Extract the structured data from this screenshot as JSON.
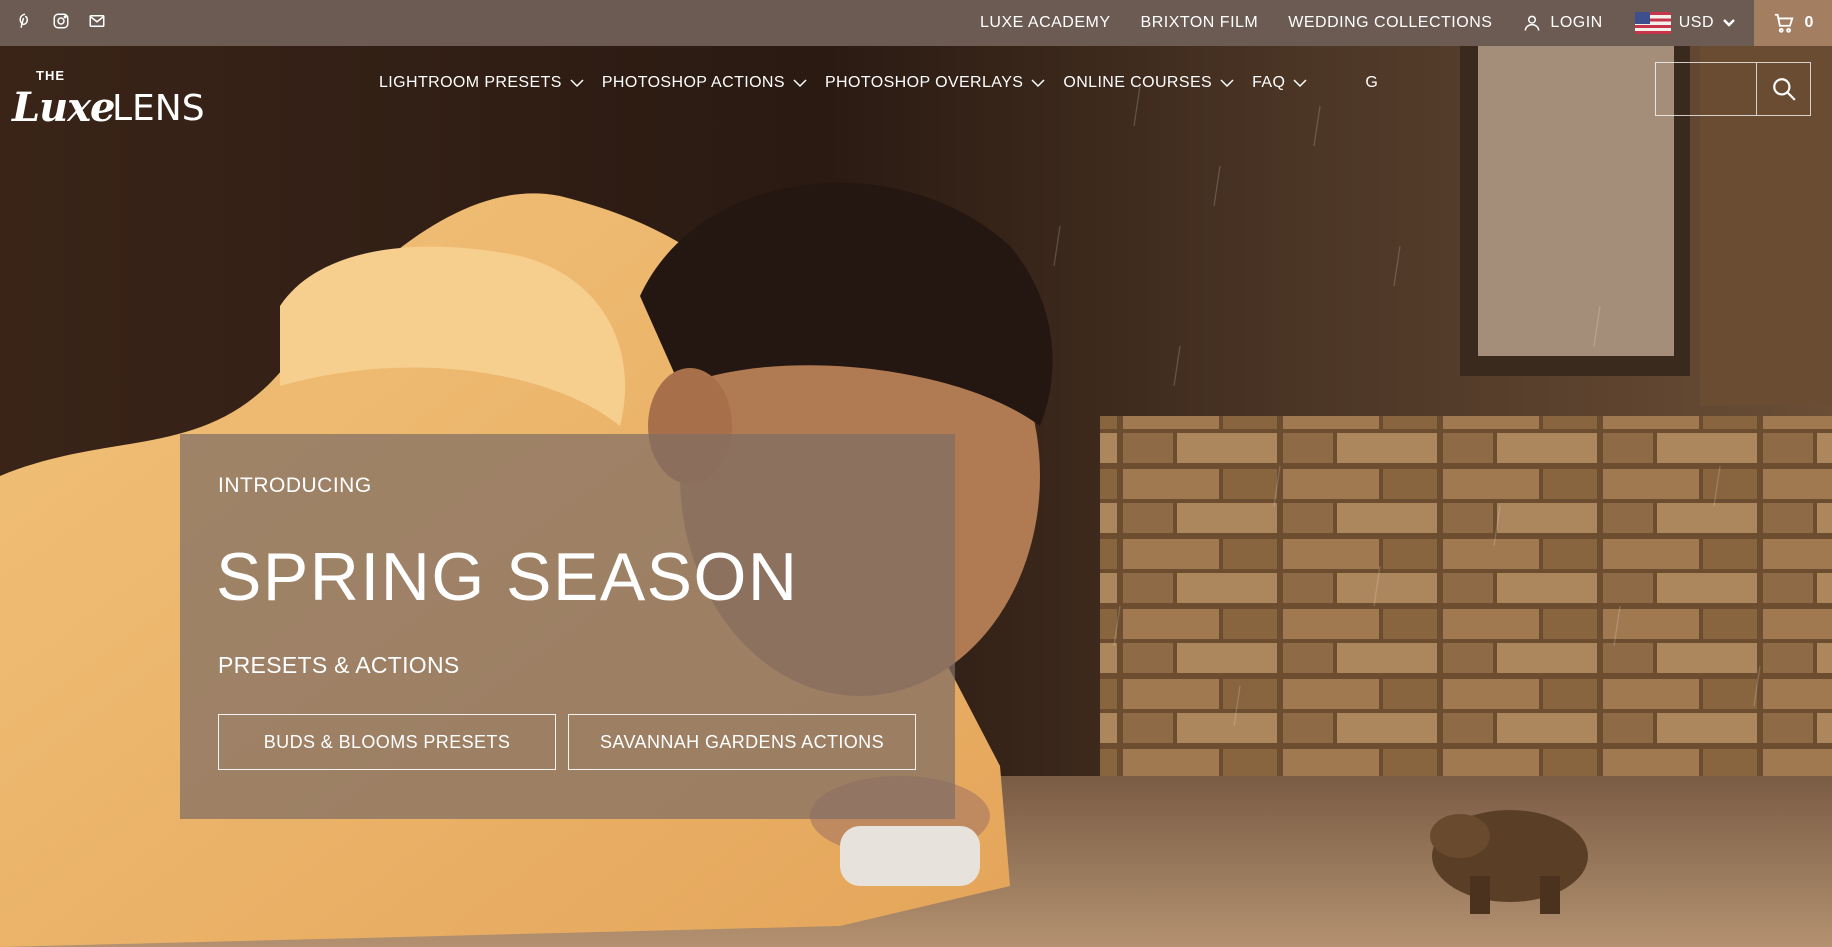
{
  "topbar": {
    "social": [
      "pinterest-icon",
      "instagram-icon",
      "email-icon"
    ],
    "links": [
      "LUXE ACADEMY",
      "BRIXTON FILM",
      "WEDDING COLLECTIONS"
    ],
    "login_label": "LOGIN",
    "currency": "USD",
    "cart_count": "0"
  },
  "logo": {
    "the": "THE",
    "luxe": "Luxe",
    "lens": "LENS"
  },
  "nav": {
    "items": [
      "LIGHTROOM PRESETS",
      "PHOTOSHOP ACTIONS",
      "PHOTOSHOP OVERLAYS",
      "ONLINE COURSES",
      "FAQ",
      "G"
    ]
  },
  "search": {
    "placeholder": ""
  },
  "promo": {
    "eyebrow": "INTRODUCING",
    "title": "SPRING SEASON",
    "subtitle": "PRESETS & ACTIONS",
    "button_1": "BUDS & BLOOMS PRESETS",
    "button_2": "SAVANNAH GARDENS ACTIONS"
  },
  "colors": {
    "topbar_bg": "#6b5b53",
    "cart_bg": "#a37e61",
    "promo_overlay": "rgba(128,110,100,0.72)",
    "text": "#ffffff"
  }
}
